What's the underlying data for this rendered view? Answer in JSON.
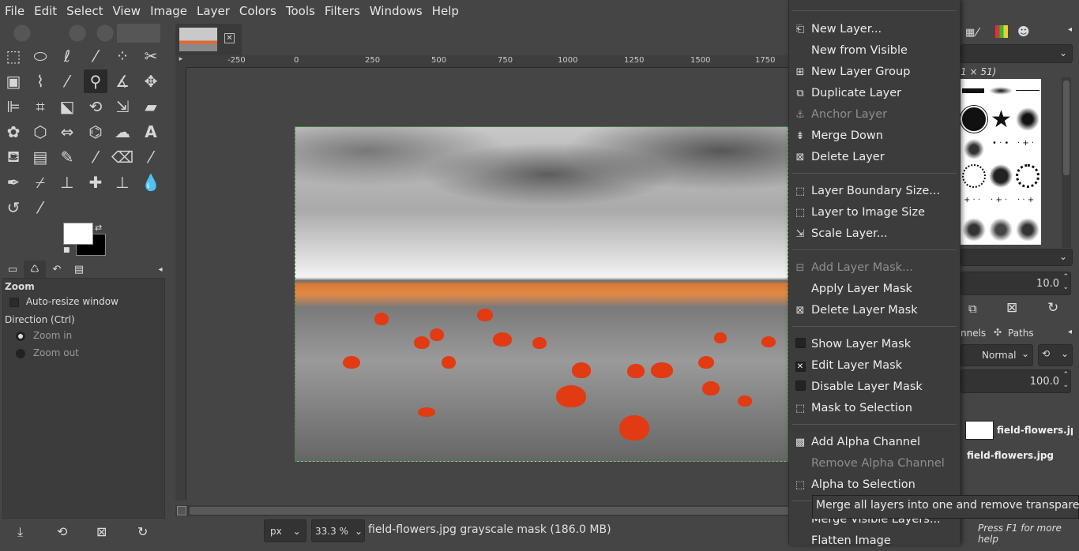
{
  "menubar": {
    "items": [
      "File",
      "Edit",
      "Select",
      "View",
      "Image",
      "Layer",
      "Colors",
      "Tools",
      "Filters",
      "Windows",
      "Help"
    ]
  },
  "tool_options": {
    "title": "Zoom",
    "auto_resize_label": "Auto-resize window",
    "auto_resize_checked": false,
    "direction_label": "Direction  (Ctrl)",
    "zoom_in_label": "Zoom in",
    "zoom_out_label": "Zoom out",
    "selected_direction": "Zoom in"
  },
  "rulers": {
    "h_ticks": [
      "-250",
      "0",
      "250",
      "500",
      "750",
      "1000",
      "1250",
      "1500",
      "1750"
    ]
  },
  "statusbar": {
    "unit": "px",
    "zoom": "33.3 %",
    "text": "field-flowers.jpg grayscale mask (186.0 MB)"
  },
  "right_dock": {
    "brush_size_text": "1 × 51)",
    "spacing_value": "10.0",
    "tabs_label_channels": "nnels",
    "tabs_label_paths": "Paths",
    "mode": "Normal",
    "opacity": "100.0",
    "layers": [
      "field-flowers.jpg",
      "field-flowers.jpg"
    ]
  },
  "layer_menu": {
    "items": [
      {
        "label": "New Layer...",
        "icon": "new-layer-icon",
        "enabled": true
      },
      {
        "label": "New from Visible",
        "icon": "",
        "enabled": true
      },
      {
        "label": "New Layer Group",
        "icon": "new-layer-group-icon",
        "enabled": true
      },
      {
        "label": "Duplicate Layer",
        "icon": "duplicate-layer-icon",
        "enabled": true
      },
      {
        "label": "Anchor Layer",
        "icon": "anchor-icon",
        "enabled": false
      },
      {
        "label": "Merge Down",
        "icon": "merge-down-icon",
        "enabled": true
      },
      {
        "label": "Delete Layer",
        "icon": "delete-icon",
        "enabled": true
      },
      {
        "label": "Layer Boundary Size...",
        "icon": "layer-boundary-icon",
        "enabled": true
      },
      {
        "label": "Layer to Image Size",
        "icon": "layer-to-image-icon",
        "enabled": true
      },
      {
        "label": "Scale Layer...",
        "icon": "scale-layer-icon",
        "enabled": true
      },
      {
        "label": "Add Layer Mask...",
        "icon": "add-mask-icon",
        "enabled": false
      },
      {
        "label": "Apply Layer Mask",
        "icon": "",
        "enabled": true
      },
      {
        "label": "Delete Layer Mask",
        "icon": "delete-mask-icon",
        "enabled": true
      },
      {
        "label": "Show Layer Mask",
        "icon": "checkbox",
        "checked": false,
        "enabled": true
      },
      {
        "label": "Edit Layer Mask",
        "icon": "checkbox",
        "checked": true,
        "enabled": true
      },
      {
        "label": "Disable Layer Mask",
        "icon": "checkbox",
        "checked": false,
        "enabled": true
      },
      {
        "label": "Mask to Selection",
        "icon": "mask-to-selection-icon",
        "enabled": true
      },
      {
        "label": "Add Alpha Channel",
        "icon": "alpha-channel-icon",
        "enabled": true
      },
      {
        "label": "Remove Alpha Channel",
        "icon": "",
        "enabled": false
      },
      {
        "label": "Alpha to Selection",
        "icon": "alpha-to-selection-icon",
        "enabled": true
      },
      {
        "label": "Merge Visible Layers...",
        "icon": "",
        "enabled": true
      },
      {
        "label": "Flatten Image",
        "icon": "",
        "enabled": true
      }
    ]
  },
  "tooltip": {
    "text": "Merge all layers into one and remove transparency",
    "help": "Press F1 for more help"
  }
}
